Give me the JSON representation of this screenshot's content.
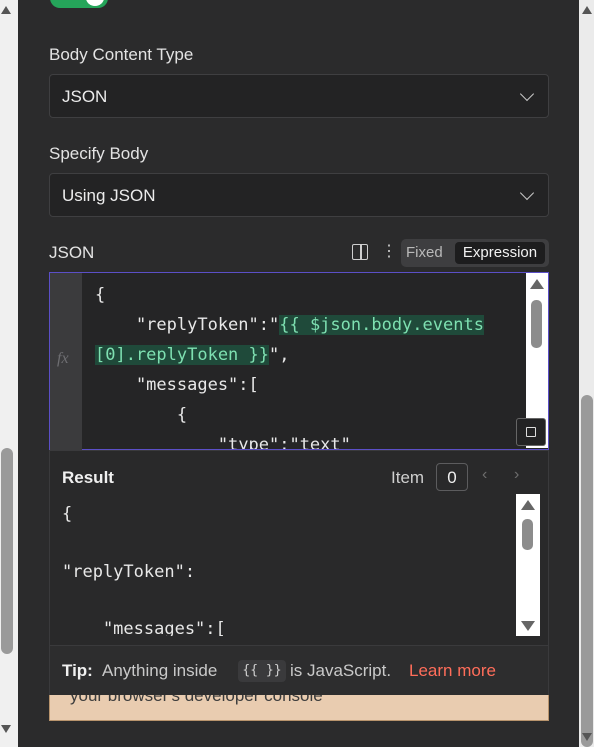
{
  "body_content_type": {
    "label": "Body Content Type",
    "value": "JSON"
  },
  "specify_body": {
    "label": "Specify Body",
    "value": "Using JSON"
  },
  "json_field": {
    "label": "JSON",
    "mode_fixed": "Fixed",
    "mode_expression": "Expression",
    "fx_label": "fx",
    "lines": {
      "l1": "{",
      "l2_prefix": "    \"replyToken\":\"",
      "l2_expr": "{{ $json.body.events",
      "l3_expr": "[0].replyToken }}",
      "l3_suffix": "\",",
      "l4": "    \"messages\":[",
      "l5": "        {",
      "l6": "            \"type\":\"text\""
    }
  },
  "result": {
    "title": "Result",
    "item_label": "Item",
    "item_index": "0",
    "lines": {
      "r1": "{",
      "r2": "\"replyToken\":",
      "r3": "    \"messages\":["
    }
  },
  "tip": {
    "label": "Tip:",
    "text_before": "Anything inside",
    "code": "{{ }}",
    "text_after": "is JavaScript.",
    "link": "Learn more"
  },
  "warning": {
    "text": "your browser's developer console"
  },
  "colors": {
    "accent": "#5b4fc7",
    "toggle": "#25a55a",
    "link": "#ff6d5a",
    "expression_highlight": "#7ee0b1"
  }
}
